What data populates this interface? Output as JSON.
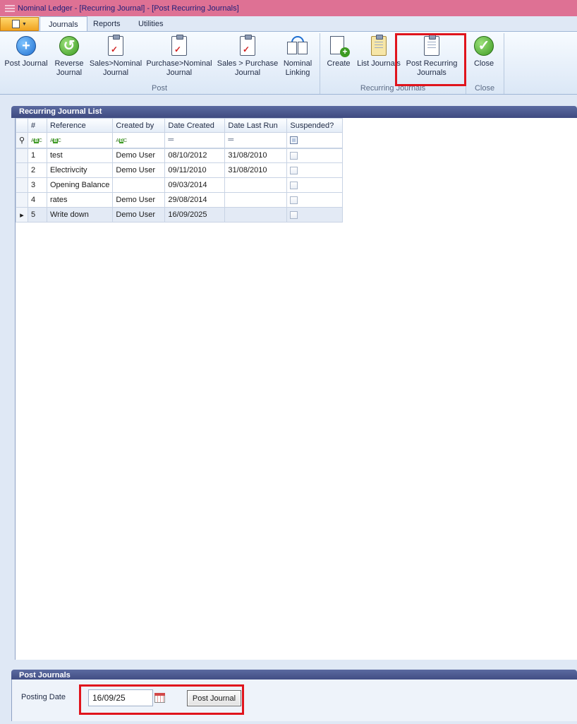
{
  "window": {
    "title": "Nominal Ledger - [Recurring Journal] - [Post Recurring Journals]"
  },
  "tabs": [
    {
      "label": "Journals",
      "active": true
    },
    {
      "label": "Reports",
      "active": false
    },
    {
      "label": "Utilities",
      "active": false
    }
  ],
  "ribbon": {
    "groups": {
      "post": "Post",
      "recurring": "Recurring Journals",
      "close": "Close"
    },
    "buttons": {
      "post_journal": "Post Journal",
      "reverse_journal_1": "Reverse",
      "reverse_journal_2": "Journal",
      "sales_nominal_1": "Sales>Nominal",
      "sales_nominal_2": "Journal",
      "purchase_nominal_1": "Purchase>Nominal",
      "purchase_nominal_2": "Journal",
      "sales_purchase_1": "Sales > Purchase",
      "sales_purchase_2": "Journal",
      "nominal_linking_1": "Nominal",
      "nominal_linking_2": "Linking",
      "create": "Create",
      "list_journals": "List Journals",
      "post_recurring_1": "Post Recurring",
      "post_recurring_2": "Journals",
      "close": "Close"
    }
  },
  "list": {
    "title": "Recurring Journal List",
    "columns": [
      "#",
      "Reference",
      "Created by",
      "Date Created",
      "Date Last Run",
      "Suspended?"
    ],
    "rows": [
      {
        "num": "1",
        "reference": "test",
        "created_by": "Demo User",
        "date_created": "08/10/2012",
        "date_last_run": "31/08/2010",
        "suspended": false
      },
      {
        "num": "2",
        "reference": "Electrivcity",
        "created_by": "Demo User",
        "date_created": "09/11/2010",
        "date_last_run": "31/08/2010",
        "suspended": false
      },
      {
        "num": "3",
        "reference": "Opening Balance",
        "created_by": "",
        "date_created": "09/03/2014",
        "date_last_run": "",
        "suspended": false
      },
      {
        "num": "4",
        "reference": "rates",
        "created_by": "Demo User",
        "date_created": "29/08/2014",
        "date_last_run": "",
        "suspended": false
      },
      {
        "num": "5",
        "reference": "Write down",
        "created_by": "Demo User",
        "date_created": "16/09/2025",
        "date_last_run": "",
        "suspended": false
      }
    ]
  },
  "post_panel": {
    "title": "Post Journals",
    "posting_date_label": "Posting Date",
    "posting_date_value": "16/09/25",
    "post_button": "Post Journal"
  },
  "colors": {
    "titlebar": "#de7194",
    "panel_header": "#3e4a80",
    "highlight": "#e0141c"
  }
}
